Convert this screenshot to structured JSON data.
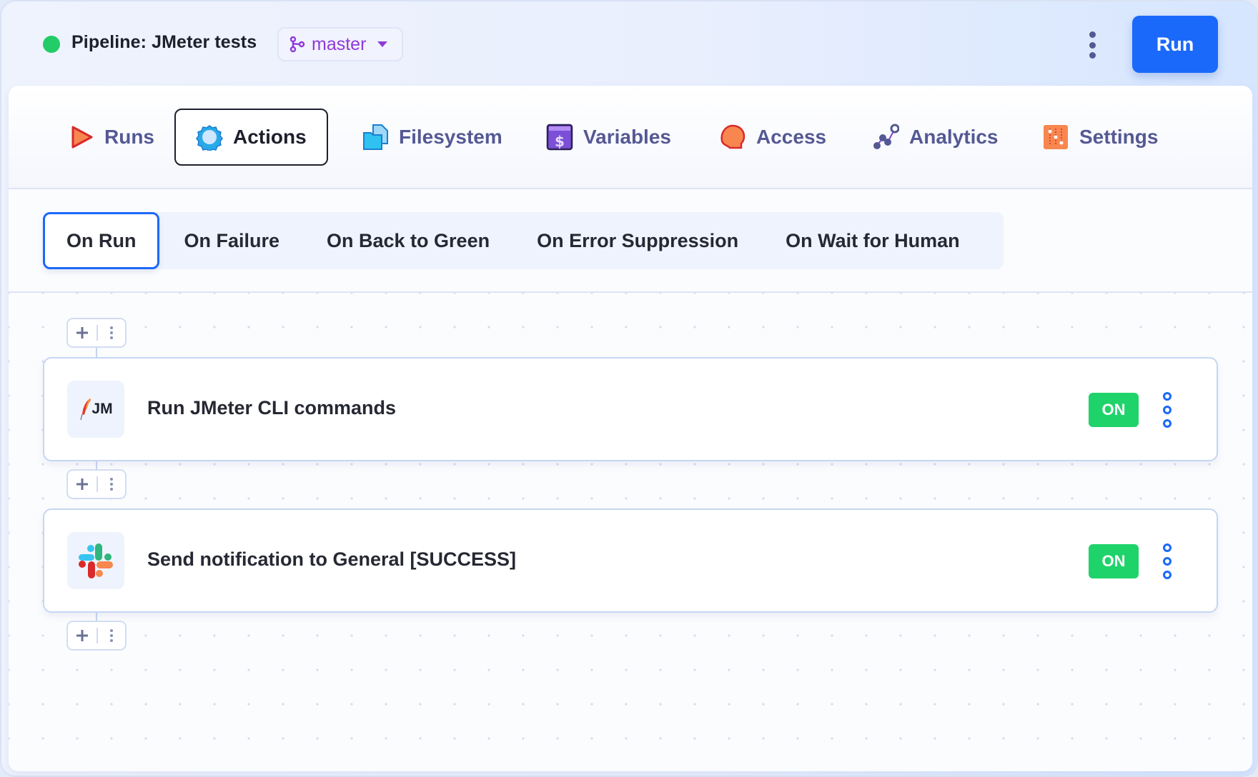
{
  "header": {
    "status_color": "#22cc66",
    "pipeline_title": "Pipeline: JMeter tests",
    "branch": {
      "icon": "git-branch-icon",
      "label": "master"
    },
    "more_icon": "kebab-icon",
    "run_label": "Run"
  },
  "tabs": [
    {
      "label": "Runs",
      "icon": "play-icon",
      "active": false
    },
    {
      "label": "Actions",
      "icon": "gear-icon",
      "active": true
    },
    {
      "label": "Filesystem",
      "icon": "file-folder-icon",
      "active": false
    },
    {
      "label": "Variables",
      "icon": "dollar-icon",
      "active": false
    },
    {
      "label": "Access",
      "icon": "head-icon",
      "active": false
    },
    {
      "label": "Analytics",
      "icon": "analytics-icon",
      "active": false
    },
    {
      "label": "Settings",
      "icon": "sliders-icon",
      "active": false
    }
  ],
  "subtabs": [
    {
      "label": "On Run",
      "active": true
    },
    {
      "label": "On Failure",
      "active": false
    },
    {
      "label": "On Back to Green",
      "active": false
    },
    {
      "label": "On Error Suppression",
      "active": false
    },
    {
      "label": "On Wait for Human",
      "active": false
    }
  ],
  "actions": [
    {
      "title": "Run JMeter CLI commands",
      "icon": "jmeter-icon",
      "icon_text": "JM",
      "status": "ON"
    },
    {
      "title": "Send notification to General [SUCCESS]",
      "icon": "slack-icon",
      "status": "ON"
    }
  ],
  "colors": {
    "accent": "#1b69fa",
    "on_badge": "#1fd36b",
    "tab_text": "#545994",
    "branch": "#8f3ad8"
  }
}
